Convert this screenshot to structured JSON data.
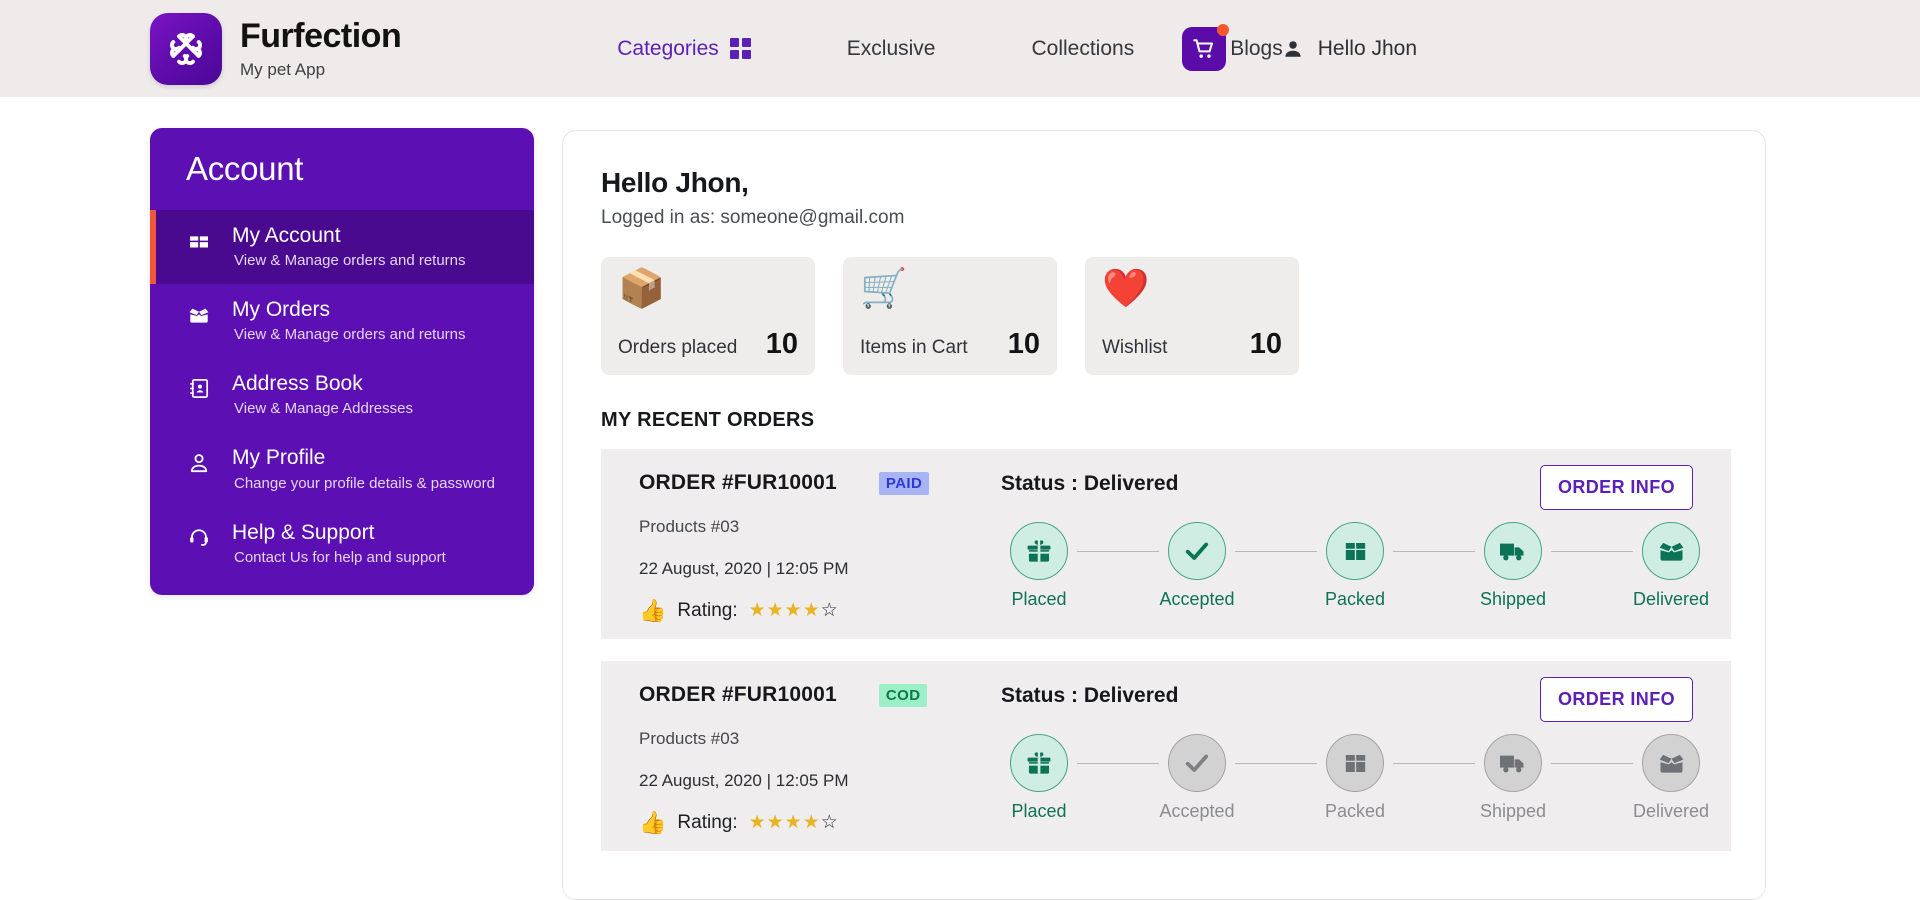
{
  "header": {
    "brand_title": "Furfection",
    "brand_subtitle": "My pet App",
    "nav": [
      {
        "label": "Categories",
        "active": true,
        "has_grid_icon": true
      },
      {
        "label": "Exclusive",
        "active": false,
        "has_grid_icon": false
      },
      {
        "label": "Collections",
        "active": false,
        "has_grid_icon": false
      },
      {
        "label": "Blogs",
        "active": false,
        "has_grid_icon": false
      }
    ],
    "cart_icon": "shopping-cart-icon",
    "cart_has_notification": true,
    "user_greeting": "Hello Jhon",
    "colors": {
      "header_bg": "#EFEBEB",
      "brand_purple": "#5B0BA8",
      "accent_red": "#F8572E"
    }
  },
  "sidebar": {
    "title": "Account",
    "items": [
      {
        "label": "My Account",
        "desc": "View & Manage orders and returns",
        "icon": "box-icon",
        "active": true
      },
      {
        "label": "My Orders",
        "desc": "View & Manage orders and returns",
        "icon": "open-box-icon",
        "active": false
      },
      {
        "label": "Address Book",
        "desc": "View & Manage Addresses",
        "icon": "address-book-icon",
        "active": false
      },
      {
        "label": "My Profile",
        "desc": "Change your profile details & password",
        "icon": "person-icon",
        "active": false
      },
      {
        "label": "Help & Support",
        "desc": "Contact Us for help and support",
        "icon": "headset-icon",
        "active": false
      }
    ],
    "colors": {
      "bg": "#5C0FB2",
      "active_bg": "#4A0A90",
      "active_bar": "#F2563C"
    }
  },
  "main": {
    "greeting": "Hello Jhon,",
    "logged_in_as": "Logged in as: someone@gmail.com",
    "stats": [
      {
        "icon": "package-icon",
        "glyph": "📦",
        "label": "Orders placed",
        "value": "10"
      },
      {
        "icon": "cart-icon",
        "glyph": "🛒",
        "label": "Items in Cart",
        "value": "10"
      },
      {
        "icon": "heart-icon",
        "glyph": "❤️",
        "label": "Wishlist",
        "value": "10"
      }
    ],
    "section_title": "MY RECENT ORDERS",
    "orders": [
      {
        "order_id": "ORDER #FUR10001",
        "badge": "PAID",
        "badge_type": "paid",
        "products": "Products #03",
        "date": "22 August, 2020 | 12:05 PM",
        "rating_label": "Rating:",
        "rating_value": 4,
        "rating_max": 5,
        "status": "Status : Delivered",
        "button_label": "ORDER INFO",
        "steps": [
          {
            "label": "Placed",
            "icon": "gift-icon",
            "active": true
          },
          {
            "label": "Accepted",
            "icon": "check-icon",
            "active": true
          },
          {
            "label": "Packed",
            "icon": "box-icon",
            "active": true
          },
          {
            "label": "Shipped",
            "icon": "truck-icon",
            "active": true
          },
          {
            "label": "Delivered",
            "icon": "open-box-icon",
            "active": true
          }
        ]
      },
      {
        "order_id": "ORDER #FUR10001",
        "badge": "COD",
        "badge_type": "cod",
        "products": "Products #03",
        "date": "22 August, 2020 | 12:05 PM",
        "rating_label": "Rating:",
        "rating_value": 4,
        "rating_max": 5,
        "status": "Status : Delivered",
        "button_label": "ORDER INFO",
        "steps": [
          {
            "label": "Placed",
            "icon": "gift-icon",
            "active": true
          },
          {
            "label": "Accepted",
            "icon": "check-icon",
            "active": false
          },
          {
            "label": "Packed",
            "icon": "box-icon",
            "active": false
          },
          {
            "label": "Shipped",
            "icon": "truck-icon",
            "active": false
          },
          {
            "label": "Delivered",
            "icon": "open-box-icon",
            "active": false
          }
        ]
      }
    ]
  }
}
